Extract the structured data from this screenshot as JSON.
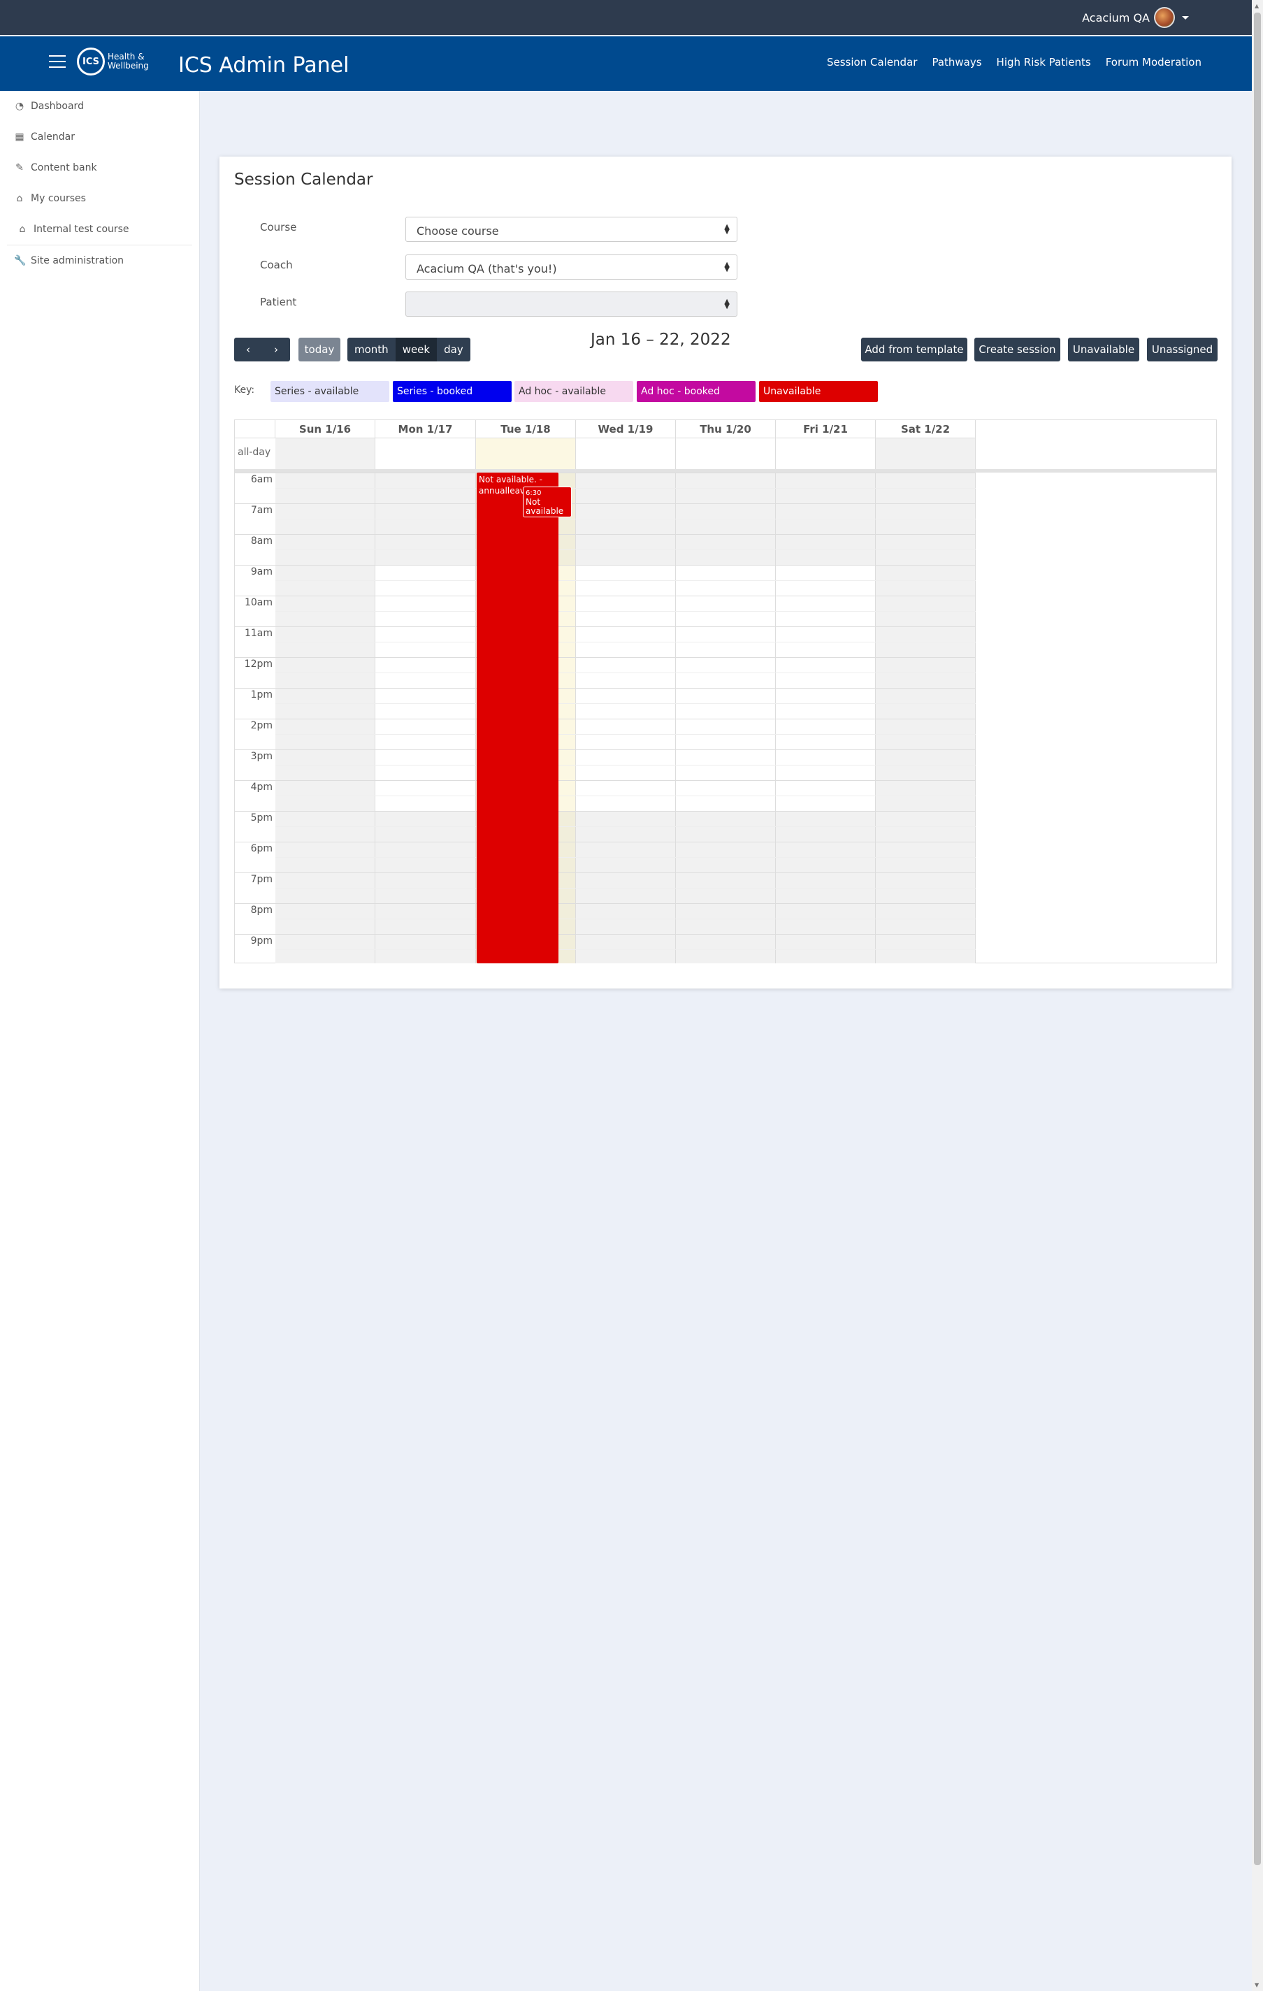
{
  "user": {
    "name": "Acacium QA"
  },
  "header": {
    "logo_mark": "ICS",
    "logo_line1": "Health &",
    "logo_line2": "Wellbeing",
    "title": "ICS Admin Panel",
    "nav": [
      "Session Calendar",
      "Pathways",
      "High Risk Patients",
      "Forum Moderation"
    ]
  },
  "sidebar": {
    "items": [
      {
        "label": "Dashboard",
        "icon": "dashboard-icon"
      },
      {
        "label": "Calendar",
        "icon": "calendar-icon"
      },
      {
        "label": "Content bank",
        "icon": "brush-icon"
      },
      {
        "label": "My courses",
        "icon": "graduation-cap-icon"
      },
      {
        "label": "Internal test course",
        "icon": "graduation-cap-icon"
      },
      {
        "label": "Site administration",
        "icon": "wrench-icon"
      }
    ]
  },
  "page": {
    "title": "Session Calendar",
    "form": {
      "course_label": "Course",
      "course_value": "Choose course",
      "coach_label": "Coach",
      "coach_value": "Acacium QA (that's you!)",
      "patient_label": "Patient",
      "patient_value": ""
    },
    "toolbar": {
      "today": "today",
      "views": [
        "month",
        "week",
        "day"
      ],
      "active_view": "week",
      "date_range": "Jan 16 – 22, 2022",
      "add_from_template": "Add from template",
      "create_session": "Create session",
      "unavailable": "Unavailable",
      "unassigned": "Unassigned"
    },
    "key": {
      "label": "Key:",
      "items": [
        {
          "label": "Series - available",
          "bg": "#e3e3fb",
          "fg": "#333333"
        },
        {
          "label": "Series - booked",
          "bg": "#0000ee",
          "fg": "#ffffff"
        },
        {
          "label": "Ad hoc - available",
          "bg": "#f7d9f0",
          "fg": "#333333"
        },
        {
          "label": "Ad hoc - booked",
          "bg": "#c30aa0",
          "fg": "#ffffff"
        },
        {
          "label": "Unavailable",
          "bg": "#dd0000",
          "fg": "#ffffff"
        }
      ]
    },
    "calendar": {
      "days": [
        "Sun 1/16",
        "Mon 1/17",
        "Tue 1/18",
        "Wed 1/19",
        "Thu 1/20",
        "Fri 1/21",
        "Sat 1/22"
      ],
      "all_day_label": "all-day",
      "hours": [
        "6am",
        "7am",
        "8am",
        "9am",
        "10am",
        "11am",
        "12pm",
        "1pm",
        "2pm",
        "3pm",
        "4pm",
        "5pm",
        "6pm",
        "7pm",
        "8pm",
        "9pm"
      ],
      "events": [
        {
          "text": "Not available. - annualleave"
        },
        {
          "time": "6:30",
          "text": "Not available"
        }
      ]
    }
  }
}
